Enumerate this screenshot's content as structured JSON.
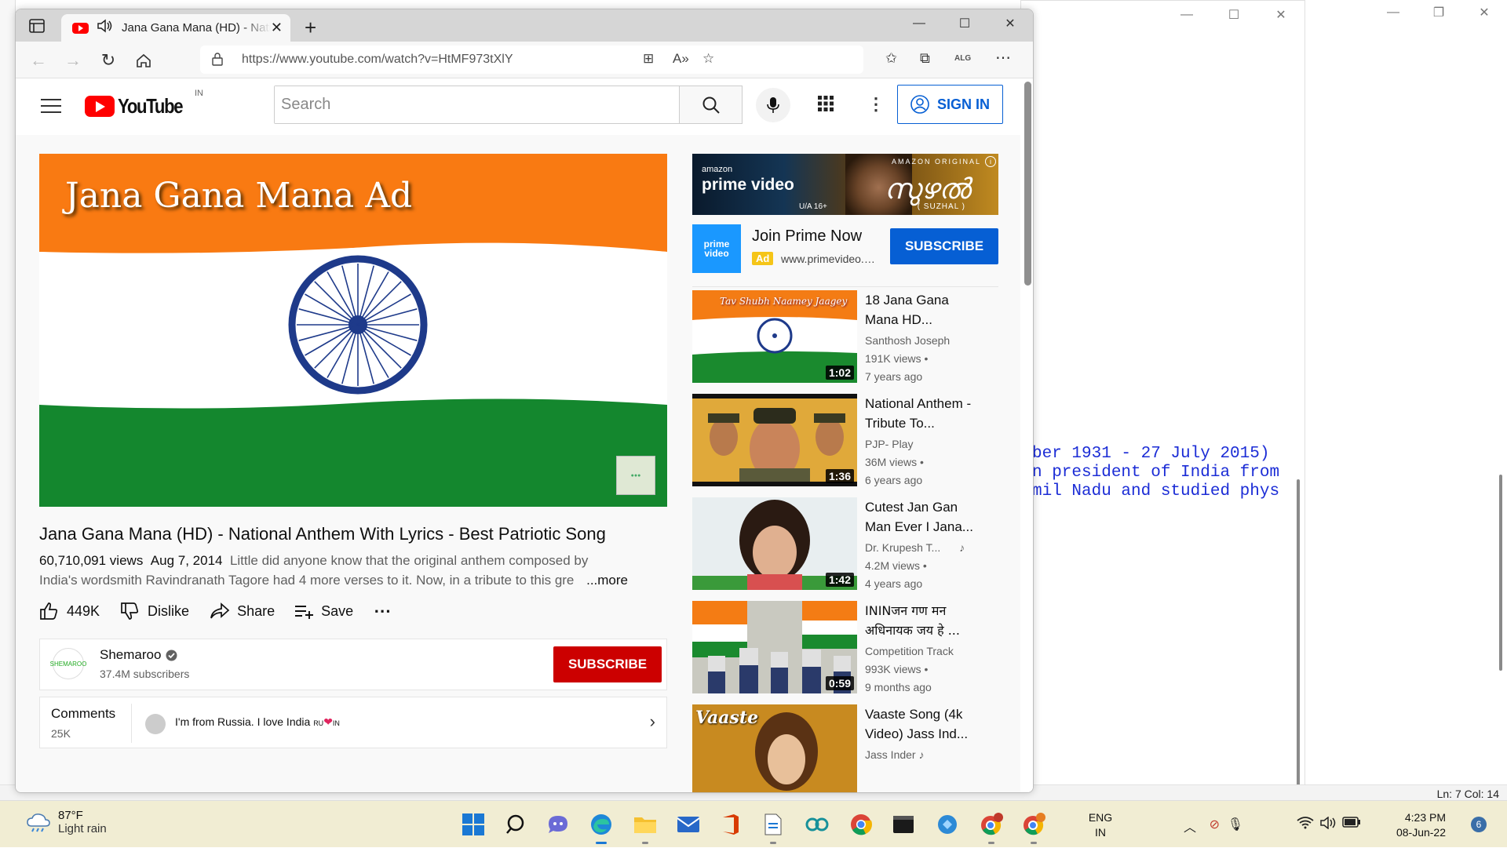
{
  "background": {
    "notepad_text": [
      "ber 1931 - 27 July 2015)",
      "n president of India from",
      "mil Nadu and studied phys"
    ],
    "status_lncol": "Ln: 7  Col: 14"
  },
  "browser": {
    "tab_title": "Jana Gana Mana (HD) - National Anthem With Lyrics - Best Patriotic Song",
    "url": "https://www.youtube.com/watch?v=HtMF973tXlY"
  },
  "youtube": {
    "logo_text": "YouTube",
    "country_code": "IN",
    "search_placeholder": "Search",
    "sign_in": "SIGN IN",
    "player_overlay_title": "Jana Gana Mana Ad",
    "video_title": "Jana Gana Mana (HD) - National Anthem With Lyrics - Best Patriotic Song",
    "views": "60,710,091 views",
    "date": "Aug 7, 2014",
    "description_line1": "Little did anyone know that the original anthem composed by",
    "description_line2": "India's wordsmith Ravindranath Tagore had 4 more verses to it. Now, in a tribute to this gre",
    "more": "...more",
    "actions": {
      "like_count": "449K",
      "dislike": "Dislike",
      "share": "Share",
      "save": "Save"
    },
    "channel": {
      "name": "Shemaroo",
      "subscribers": "37.4M subscribers",
      "subscribe": "SUBSCRIBE"
    },
    "comments": {
      "label": "Comments",
      "count": "25K",
      "top_comment": "I'm from Russia. I love India",
      "flag_ru": "RU",
      "flag_in": "IN"
    },
    "ad_banner": {
      "brand_small": "amazon",
      "brand": "prime video",
      "tag": "AMAZON ORIGINAL",
      "title": "സുഴൽ",
      "subtitle": "( SUZHAL )",
      "rating": "U/A 16+"
    },
    "promo": {
      "logo_text": "prime video",
      "title": "Join Prime Now",
      "ad_label": "Ad",
      "domain": "www.primevideo.com",
      "button": "SUBSCRIBE"
    },
    "recommended": [
      {
        "title": "18 Jana Gana Mana HD...",
        "channel": "Santhosh Joseph",
        "views": "191K views",
        "age": "7 years ago",
        "duration": "1:02",
        "thumb_text": "Tav Shubh Naamey Jaagey"
      },
      {
        "title": "National Anthem - Tribute To...",
        "channel": "PJP- Play",
        "views": "36M views",
        "age": "6 years ago",
        "duration": "1:36"
      },
      {
        "title": "Cutest Jan Gan Man Ever I Jana...",
        "channel": "Dr. Krupesh T...",
        "views": "4.2M views",
        "age": "4 years ago",
        "duration": "1:42"
      },
      {
        "title": "ININजन गण मन अधिनायक जय हे ...",
        "channel": "Competition Track",
        "views": "993K views",
        "age": "9 months ago",
        "duration": "0:59"
      },
      {
        "title": "Vaaste Song (4k Video) Jass Ind...",
        "channel": "Jass Inder",
        "thumb_text": "Vaaste"
      }
    ]
  },
  "taskbar": {
    "temperature": "87°F",
    "weather": "Light rain",
    "lang1": "ENG",
    "lang2": "IN",
    "time": "4:23 PM",
    "date": "08-Jun-22",
    "notification_count": "6"
  }
}
